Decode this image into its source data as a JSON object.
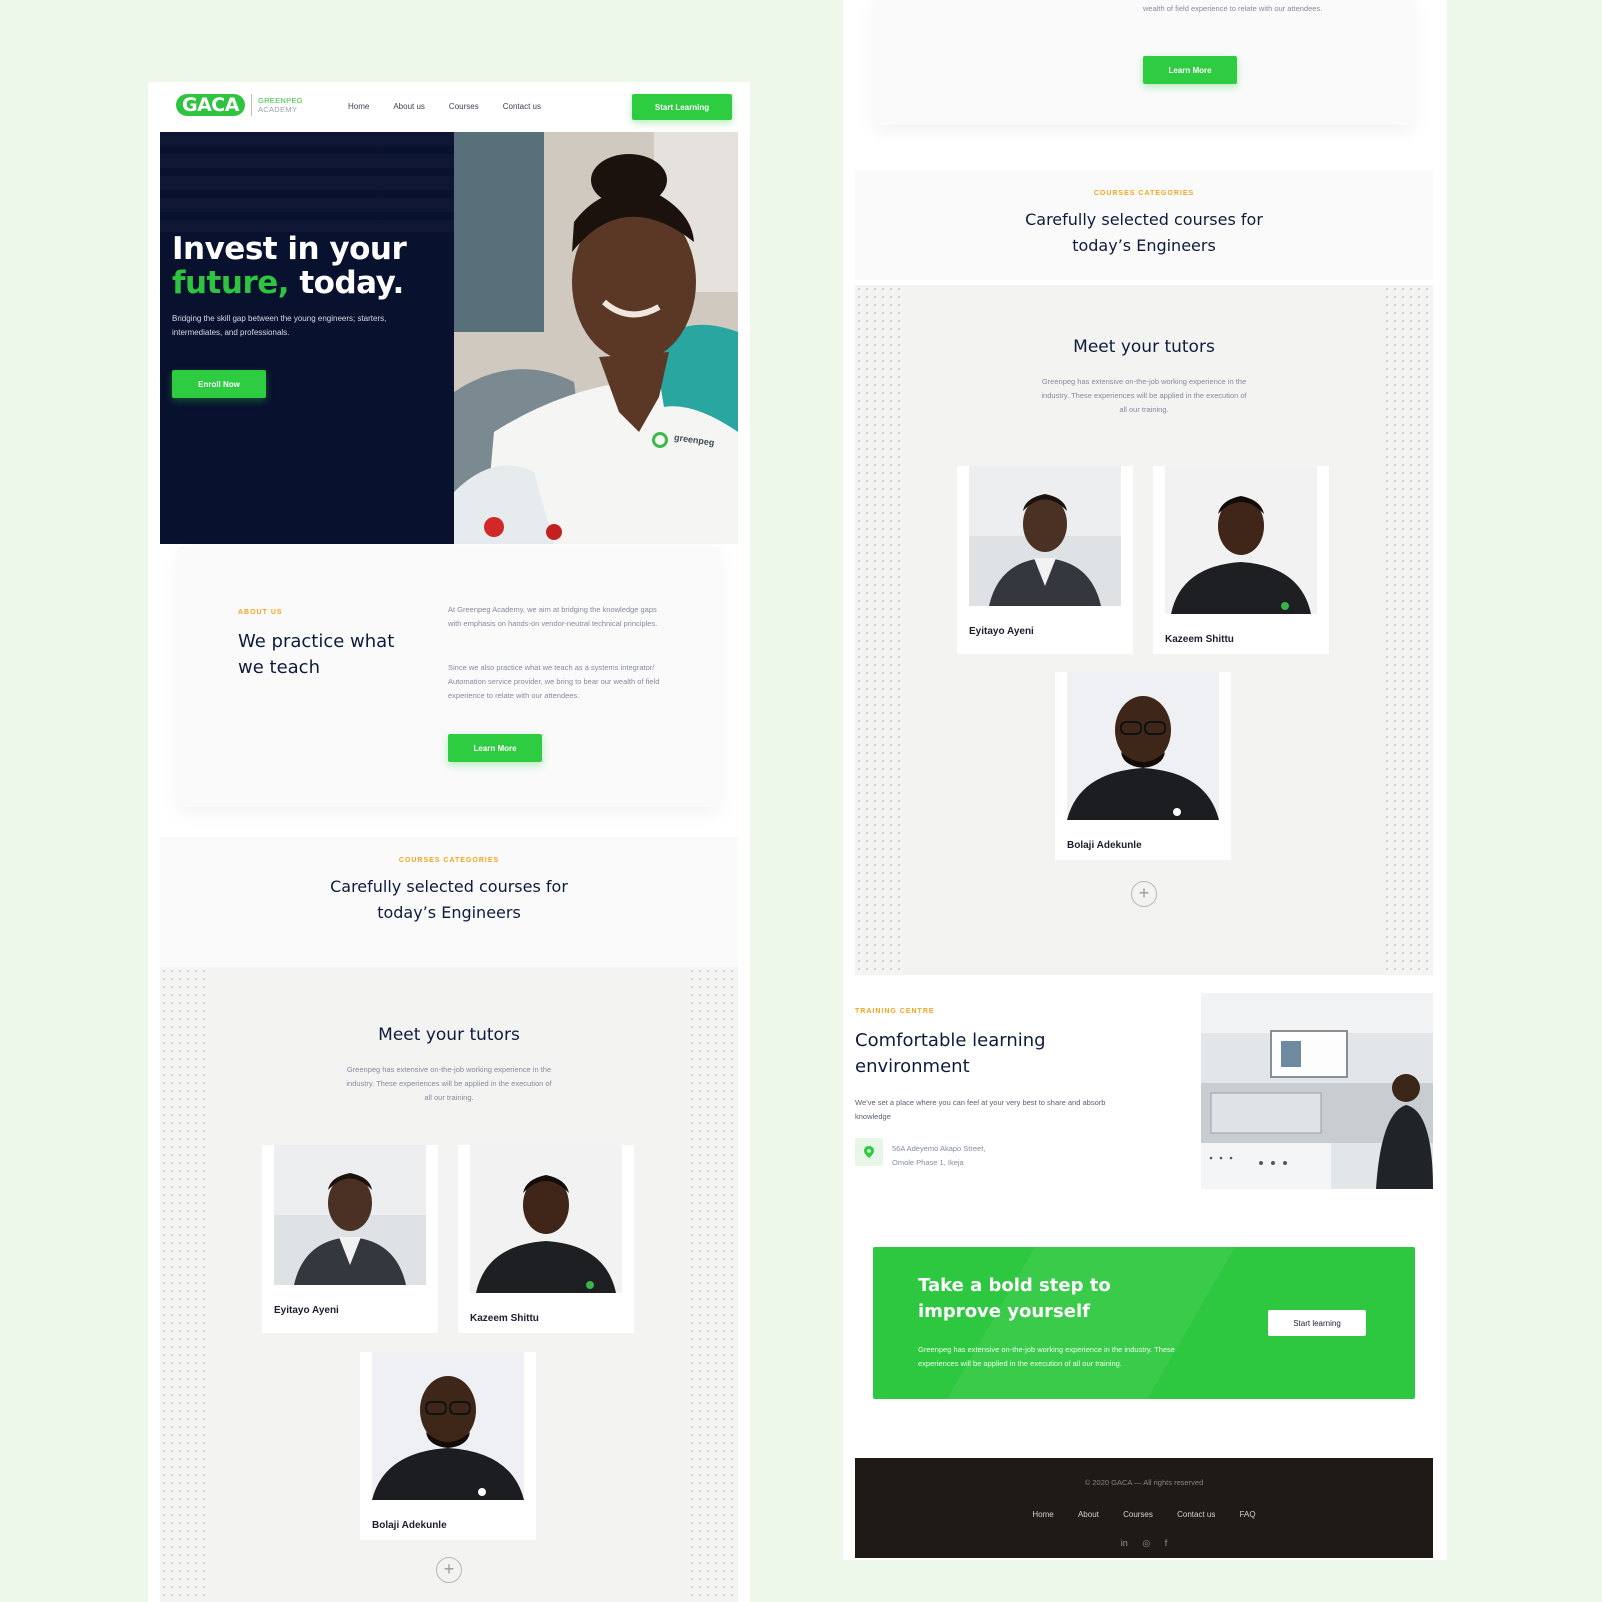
{
  "brand": {
    "logo_mark": "GACA",
    "logo_line1": "GREENPEG",
    "logo_line2": "ACADEMY",
    "green": "#2ecc40",
    "navy": "#08112e",
    "orange": "#f3a51d"
  },
  "nav": {
    "items": [
      "Home",
      "About us",
      "Courses",
      "Contact us"
    ],
    "cta": "Start Learning"
  },
  "hero": {
    "title_line1": "Invest in your",
    "title_green": "future,",
    "title_end": " today.",
    "subtitle": "Bridging the skill gap between the young engineers; starters, intermediates, and professionals.",
    "button": "Enroll Now",
    "shirt_logo": "greenpeg"
  },
  "about": {
    "eyebrow": "ABOUT US",
    "title": "We practice what we teach",
    "p1": "At Greenpeg Academy, we aim at bridging the knowledge gaps with emphasis on hands-on vendor-neutral technical principles.",
    "p2": "Since we also practice what we teach as a systems integrator/ Automation service provider, we bring to bear our wealth of field experience to relate with our attendees.",
    "p2_tail": "integrator/ Automation service provider, we bring to bear our wealth of field experience to relate with our attendees.",
    "button": "Learn More"
  },
  "courses": {
    "eyebrow": "COURSES CATEGORIES",
    "title": "Carefully selected courses for today’s Engineers"
  },
  "tutors": {
    "title": "Meet your tutors",
    "description": "Greenpeg has extensive on-the-job working experience in the industry. These experiences will be applied in the execution of all our training.",
    "list": [
      {
        "name": "Eyitayo Ayeni"
      },
      {
        "name": "Kazeem Shittu"
      },
      {
        "name": "Bolaji Adekunle"
      }
    ],
    "more": "+"
  },
  "training": {
    "eyebrow": "TRAINING CENTRE",
    "title": "Comfortable learning environment",
    "description": "We’ve set a place where you can feel at your very best to share and absorb knowledge",
    "address_line1": "56A Adeyemo Akapo Street,",
    "address_line2": "Omole Phase 1, Ikeja"
  },
  "cta": {
    "title": "Take a bold step to improve yourself",
    "description": "Greenpeg has extensive on-the-job working experience in the industry. These experiences will be applied in the execution of all our training.",
    "button": "Start learning"
  },
  "footer": {
    "copyright": "© 2020 GACA — All rights reserved",
    "links": [
      "Home",
      "About",
      "Courses",
      "Contact us",
      "FAQ"
    ],
    "social": [
      "in",
      "◎",
      "f"
    ]
  }
}
